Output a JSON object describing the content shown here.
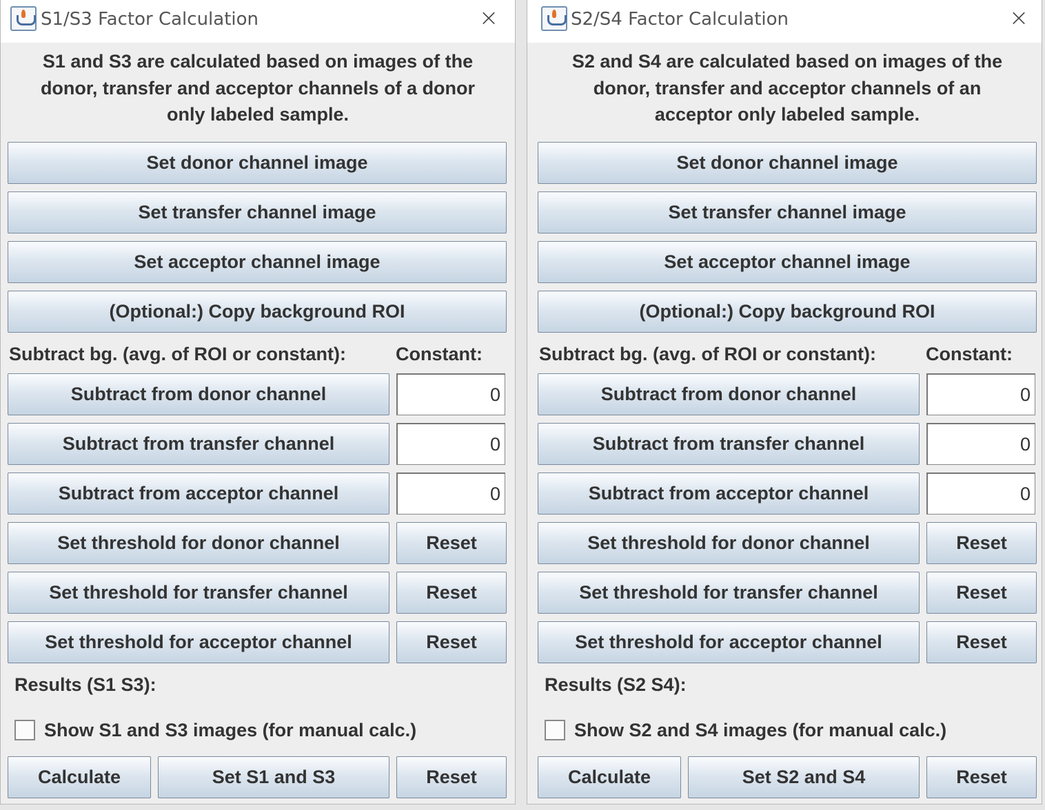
{
  "windows": [
    {
      "title": "S1/S3 Factor Calculation",
      "close_glyph": "×",
      "description": [
        "S1 and S3 are calculated based on images of the",
        "donor, transfer and acceptor channels of a donor",
        "only labeled sample."
      ],
      "buttons": {
        "set_donor": "Set donor channel image",
        "set_transfer": "Set transfer channel image",
        "set_acceptor": "Set acceptor channel image",
        "copy_roi": "(Optional:) Copy background ROI"
      },
      "subtract_label": "Subtract bg. (avg. of ROI or constant):",
      "constant_label": "Constant:",
      "subtract": [
        {
          "label": "Subtract from donor channel",
          "value": "0"
        },
        {
          "label": "Subtract from transfer channel",
          "value": "0"
        },
        {
          "label": "Subtract from acceptor channel",
          "value": "0"
        }
      ],
      "thresholds": [
        {
          "label": "Set threshold for donor channel",
          "reset": "Reset"
        },
        {
          "label": "Set threshold for transfer channel",
          "reset": "Reset"
        },
        {
          "label": "Set threshold for acceptor channel",
          "reset": "Reset"
        }
      ],
      "results_label": "Results (S1 S3):",
      "checkbox_label": "Show S1 and S3 images (for manual calc.)",
      "checkbox_checked": false,
      "footer": {
        "calculate": "Calculate",
        "set": "Set S1 and S3",
        "reset": "Reset"
      }
    },
    {
      "title": "S2/S4 Factor Calculation",
      "close_glyph": "×",
      "description": [
        "S2 and S4 are calculated based on images of the",
        "donor, transfer and acceptor channels of an",
        "acceptor only labeled sample."
      ],
      "buttons": {
        "set_donor": "Set donor channel image",
        "set_transfer": "Set transfer channel image",
        "set_acceptor": "Set acceptor channel image",
        "copy_roi": "(Optional:) Copy background ROI"
      },
      "subtract_label": "Subtract bg. (avg. of ROI or constant):",
      "constant_label": "Constant:",
      "subtract": [
        {
          "label": "Subtract from donor channel",
          "value": "0"
        },
        {
          "label": "Subtract from transfer channel",
          "value": "0"
        },
        {
          "label": "Subtract from acceptor channel",
          "value": "0"
        }
      ],
      "thresholds": [
        {
          "label": "Set threshold for donor channel",
          "reset": "Reset"
        },
        {
          "label": "Set threshold for transfer channel",
          "reset": "Reset"
        },
        {
          "label": "Set threshold for acceptor channel",
          "reset": "Reset"
        }
      ],
      "results_label": "Results (S2 S4):",
      "checkbox_label": "Show S2 and S4 images (for manual calc.)",
      "checkbox_checked": false,
      "footer": {
        "calculate": "Calculate",
        "set": "Set S2 and S4",
        "reset": "Reset"
      }
    }
  ]
}
